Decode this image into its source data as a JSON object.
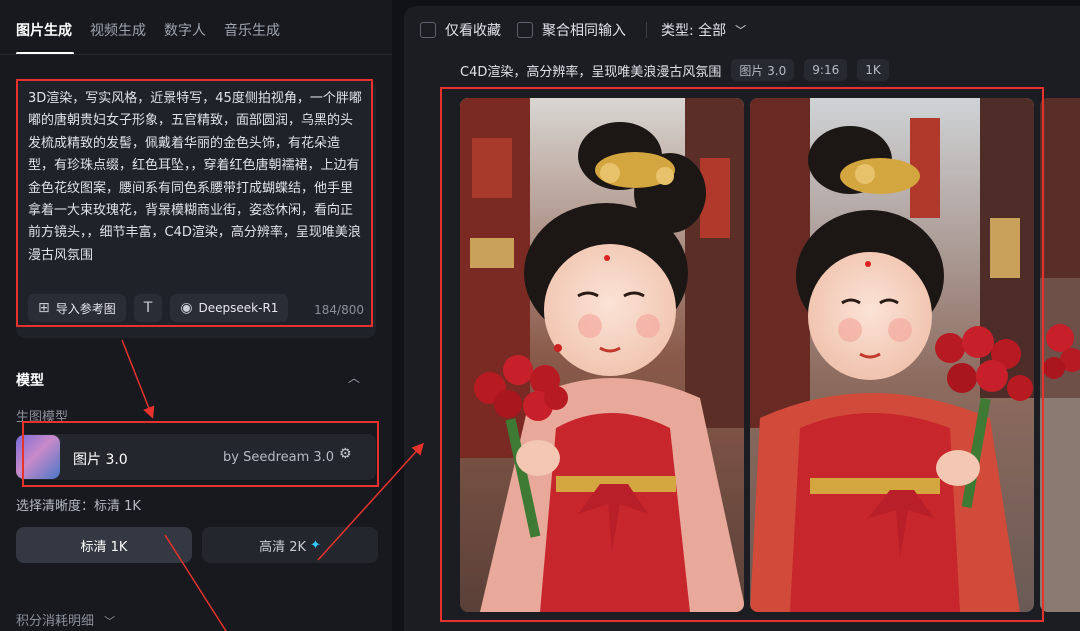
{
  "tabs": [
    {
      "label": "图片生成",
      "active": true
    },
    {
      "label": "视频生成",
      "active": false
    },
    {
      "label": "数字人",
      "active": false
    },
    {
      "label": "音乐生成",
      "active": false
    }
  ],
  "prompt": {
    "text": "3D渲染，写实风格，近景特写，45度侧拍视角，一个胖嘟嘟的唐朝贵妇女子形象，五官精致，面部圆润，乌黑的头发梳成精致的发髻，佩戴着华丽的金色头饰，有花朵造型，有珍珠点缀，红色耳坠，，穿着红色唐朝襦裙，上边有金色花纹图案，腰间系有同色系腰带打成蝴蝶结，他手里拿着一大束玫瑰花，背景模糊商业街，姿态休闲，看向正前方镜头，，细节丰富，C4D渲染，高分辨率，呈现唯美浪漫古风氛围",
    "import_ref_label": "导入参考图",
    "import_ref_icon": "image-add-icon",
    "text_tool_icon": "text-format-icon",
    "deepseek_label": "Deepseek-R1",
    "deepseek_icon": "deepseek-whale-icon",
    "counter": "184/800"
  },
  "model_section": {
    "title": "模型",
    "collapse_icon": "chevron-up-icon",
    "sub_label": "生图模型",
    "model_name": "图片 3.0",
    "model_by": "by Seedream 3.0",
    "settings_icon": "sliders-icon"
  },
  "resolution": {
    "label": "选择清晰度：标清 1K",
    "options": [
      {
        "label": "标清 1K",
        "selected": true
      },
      {
        "label": "高清 2K",
        "selected": false,
        "badge_icon": "sparkle-icon"
      }
    ]
  },
  "credits": {
    "label": "积分消耗明细",
    "icon": "chevron-down-icon"
  },
  "filters": {
    "favorites_label": "仅看收藏",
    "merge_label": "聚合相同输入",
    "type_label": "类型: 全部",
    "type_icon": "chevron-down-icon"
  },
  "result": {
    "prompt_summary": "C4D渲染，高分辨率，呈现唯美浪漫古风氛围",
    "tags": [
      "图片 3.0",
      "9:16",
      "1K"
    ]
  },
  "colors": {
    "annotation_red": "#e5322d",
    "accent_star": "#35c9ff",
    "dress_red": "#c8262d",
    "gold": "#d4a640"
  }
}
